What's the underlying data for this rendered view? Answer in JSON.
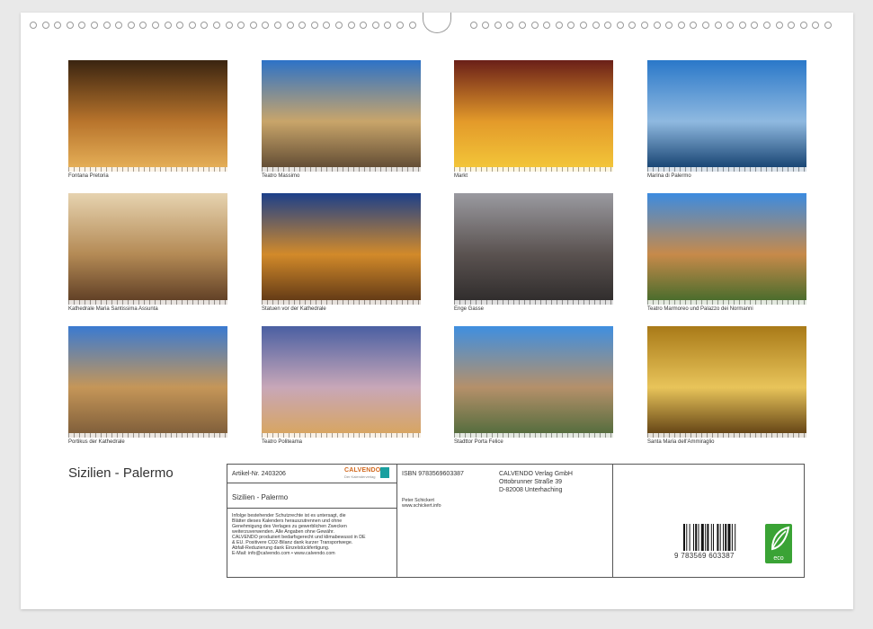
{
  "calendar": {
    "title": "Sizilien - Palermo"
  },
  "photos": [
    {
      "caption": "Fontana Pretoria",
      "colors": [
        "#3a2410",
        "#b8742c",
        "#e8b35a"
      ]
    },
    {
      "caption": "Teatro Massimo",
      "colors": [
        "#2d72c7",
        "#c9a56a",
        "#5a4630"
      ]
    },
    {
      "caption": "Markt",
      "colors": [
        "#6a1f18",
        "#e39a2a",
        "#f4c93a"
      ]
    },
    {
      "caption": "Marina di Palermo",
      "colors": [
        "#2a78c9",
        "#8fb9e0",
        "#0f3b6a"
      ]
    },
    {
      "caption": "Kathedrale Maria Santissima Assunta",
      "colors": [
        "#e6d3b0",
        "#b48a55",
        "#5a3a22"
      ]
    },
    {
      "caption": "Statuen vor der Kathedrale",
      "colors": [
        "#1c3f8a",
        "#d28a2a",
        "#5a3414"
      ]
    },
    {
      "caption": "Enge Gasse",
      "colors": [
        "#9a9aa0",
        "#5a5250",
        "#2d2a2a"
      ]
    },
    {
      "caption": "Teatro Marmoreo und Palazzo dei Normanni",
      "colors": [
        "#3c8be0",
        "#c78a4a",
        "#3f6a2a"
      ]
    },
    {
      "caption": "Portikus der Kathedrale",
      "colors": [
        "#3a7ad1",
        "#c59658",
        "#7a5a38"
      ]
    },
    {
      "caption": "Teatro Politeama",
      "colors": [
        "#4a5fa2",
        "#c8a7b8",
        "#d9a55a"
      ]
    },
    {
      "caption": "Stadttor Porta Felice",
      "colors": [
        "#3f8fe0",
        "#b5906a",
        "#4d6a3a"
      ]
    },
    {
      "caption": "Santa Maria dell'Ammiraglio",
      "colors": [
        "#a97a18",
        "#e8c45a",
        "#5a3a10"
      ]
    }
  ],
  "info": {
    "article": "Artikel-Nr. 2403206",
    "brand": "CALVENDO",
    "brand_sub": "Der Kalenderverlag",
    "product_title": "Sizilien - Palermo",
    "legal": [
      "Infolge bestehender Schutzrechte ist es untersagt, die",
      "Blätter dieses Kalenders herauszutrennen und ohne",
      "Genehmigung des Verlages zu gewerblichen Zwecken",
      "weiterzuverwenden. Alle Angaben ohne Gewähr.",
      "CALVENDO produziert bedarfsgerecht und klimabewusst in DE",
      "& EU. Positivere CO2-Bilanz dank kurzer Transportwege.",
      "Abfall-Reduzierung dank Einzelstückfertigung.",
      "E-Mail: info@calvendo.com • www.calvendo.com"
    ],
    "isbn": "ISBN 9783569603387",
    "publisher": [
      "CALVENDO Verlag GmbH",
      "Ottobrunner Straße 39",
      "D-82008 Unterhaching"
    ],
    "author": "Peter Schickert",
    "author_web": "www.schickert.info",
    "barcode_digits": "9 783569 603387",
    "eco_label": "eco"
  }
}
